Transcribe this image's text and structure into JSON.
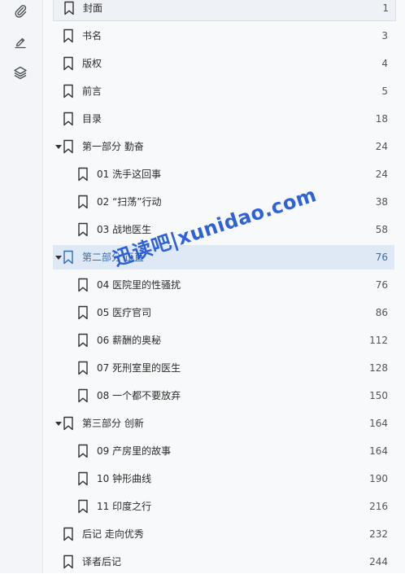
{
  "rail": {
    "icons": [
      "paperclip-icon",
      "pen-icon",
      "layers-icon"
    ]
  },
  "toc": {
    "items": [
      {
        "title": "封面",
        "page": "1",
        "level": 0,
        "expandable": false
      },
      {
        "title": "书名",
        "page": "3",
        "level": 0,
        "expandable": false
      },
      {
        "title": "版权",
        "page": "4",
        "level": 0,
        "expandable": false
      },
      {
        "title": "前言",
        "page": "5",
        "level": 0,
        "expandable": false
      },
      {
        "title": "目录",
        "page": "18",
        "level": 0,
        "expandable": false
      },
      {
        "title": "第一部分  勤奋",
        "page": "24",
        "level": 0,
        "expandable": true
      },
      {
        "title": "01  洗手这回事",
        "page": "24",
        "level": 1,
        "expandable": false
      },
      {
        "title": "02  “扫荡”行动",
        "page": "38",
        "level": 1,
        "expandable": false
      },
      {
        "title": "03  战地医生",
        "page": "58",
        "level": 1,
        "expandable": false
      },
      {
        "title": "第二部分  正直",
        "page": "76",
        "level": 0,
        "expandable": true,
        "active": true
      },
      {
        "title": "04  医院里的性骚扰",
        "page": "76",
        "level": 1,
        "expandable": false
      },
      {
        "title": "05  医疗官司",
        "page": "86",
        "level": 1,
        "expandable": false
      },
      {
        "title": "06  薪酬的奥秘",
        "page": "112",
        "level": 1,
        "expandable": false
      },
      {
        "title": "07  死刑室里的医生",
        "page": "128",
        "level": 1,
        "expandable": false
      },
      {
        "title": "08  一个都不要放弃",
        "page": "150",
        "level": 1,
        "expandable": false
      },
      {
        "title": "第三部分  创新",
        "page": "164",
        "level": 0,
        "expandable": true
      },
      {
        "title": "09  产房里的故事",
        "page": "164",
        "level": 1,
        "expandable": false
      },
      {
        "title": "10  钟形曲线",
        "page": "190",
        "level": 1,
        "expandable": false
      },
      {
        "title": "11  印度之行",
        "page": "216",
        "level": 1,
        "expandable": false
      },
      {
        "title": "后记  走向优秀",
        "page": "232",
        "level": 0,
        "expandable": false
      },
      {
        "title": "译者后记",
        "page": "244",
        "level": 0,
        "expandable": false
      }
    ]
  },
  "watermark": {
    "text": "迅读吧|xunidao.com",
    "color": "#1f56d6"
  },
  "colors": {
    "active_text": "#2f6fb8",
    "active_bg": "#dfe8f5"
  }
}
